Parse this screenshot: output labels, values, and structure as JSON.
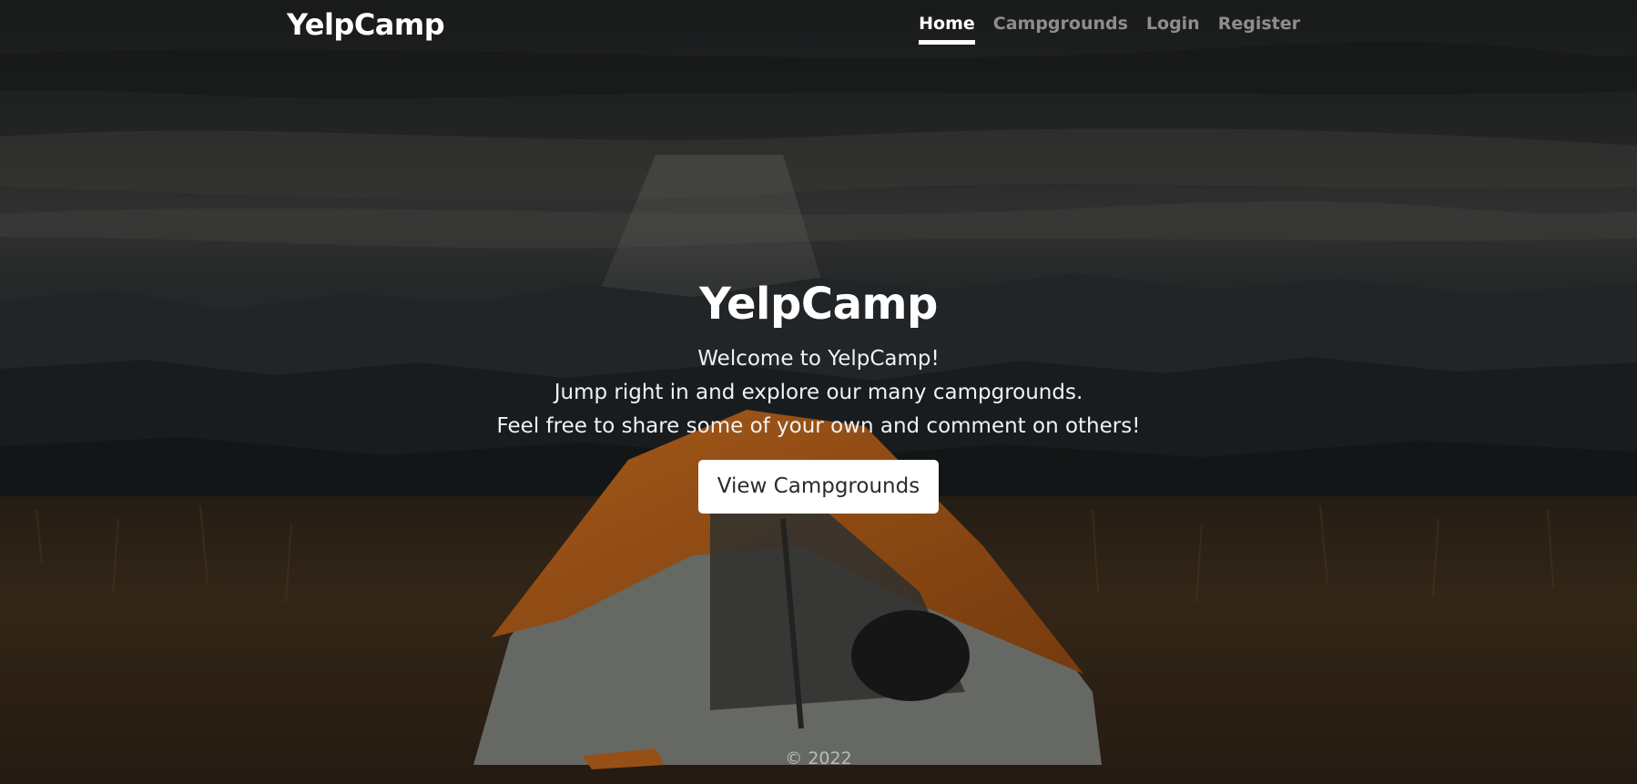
{
  "navbar": {
    "brand": "YelpCamp",
    "links": [
      {
        "label": "Home",
        "active": true
      },
      {
        "label": "Campgrounds",
        "active": false
      },
      {
        "label": "Login",
        "active": false
      },
      {
        "label": "Register",
        "active": false
      }
    ]
  },
  "hero": {
    "title": "YelpCamp",
    "lines": [
      "Welcome to YelpCamp!",
      "Jump right in and explore our many campgrounds.",
      "Feel free to share some of your own and comment on others!"
    ],
    "button_label": "View Campgrounds"
  },
  "background": {
    "subject": "orange tent in a grassy field under dark mountains and clouds",
    "colors": {
      "sky": "#2a2c2d",
      "clouds": "#4a4b48",
      "mountains": "#1c2022",
      "grass": "#3e2e1d",
      "tent": "#b8621b",
      "tent_mesh": "#8a8c88"
    }
  },
  "footer": {
    "copyright": "© 2022"
  }
}
